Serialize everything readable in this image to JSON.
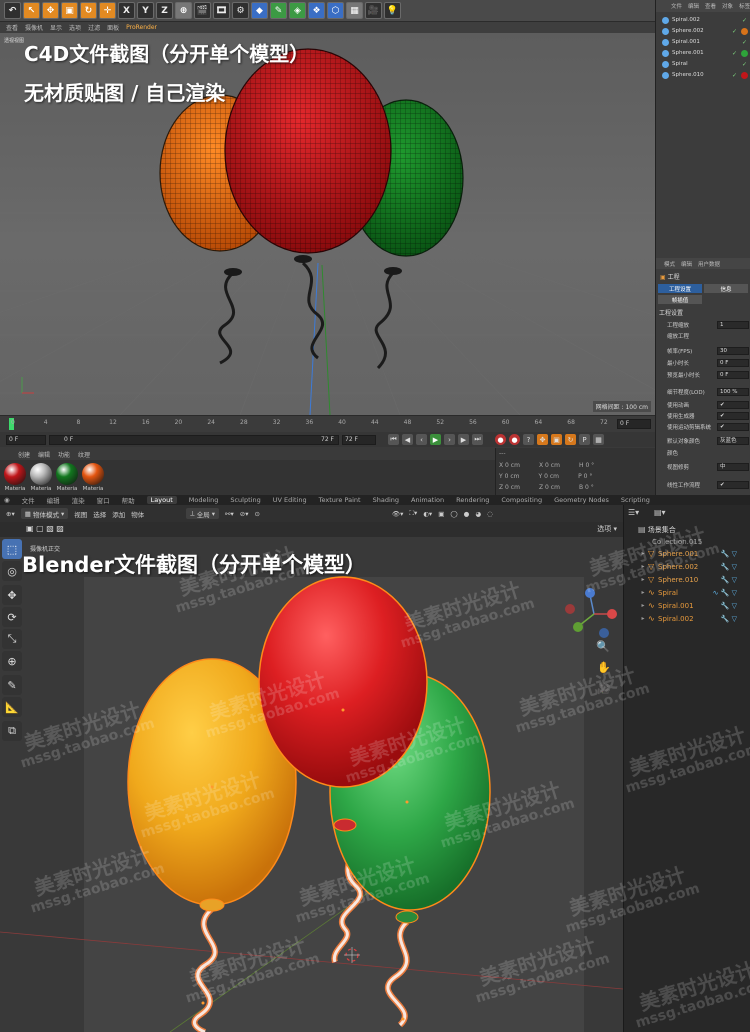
{
  "c4d": {
    "overlay_title": "C4D文件截图（分开单个模型）",
    "overlay_subtitle": "无材质贴图 / 自己渲染",
    "toolbar_xyz": [
      "X",
      "Y",
      "Z"
    ],
    "viewport_menu": [
      "查看",
      "摄像机",
      "显示",
      "选项",
      "过滤",
      "面板",
      "ProRender"
    ],
    "viewport_label": "透视视图",
    "grid_info": "网格间距 : 100 cm",
    "timeline_ticks": [
      "0",
      "4",
      "8",
      "12",
      "16",
      "20",
      "24",
      "28",
      "32",
      "36",
      "40",
      "44",
      "48",
      "52",
      "56",
      "60",
      "64",
      "68",
      "72"
    ],
    "current_frame": "0 F",
    "start_frame": "0 F",
    "range_start": "0 F",
    "range_end": "72 F",
    "end_frame": "72 F",
    "end_frame2": "72 F",
    "material_tabs": [
      "创建",
      "编辑",
      "功能",
      "纹理"
    ],
    "materials": [
      {
        "label": "Materia",
        "color": "#c0161a"
      },
      {
        "label": "Materia",
        "color": "#b8b8b8"
      },
      {
        "label": "Materia",
        "color": "#12781f"
      },
      {
        "label": "Materia",
        "color": "#e45510"
      }
    ],
    "coords": {
      "header": "---",
      "rows": [
        {
          "axis": "X",
          "pos": "0 cm",
          "axis2": "X",
          "size": "0 cm",
          "axis3": "H",
          "rot": "0 °"
        },
        {
          "axis": "Y",
          "pos": "0 cm",
          "axis2": "Y",
          "size": "0 cm",
          "axis3": "P",
          "rot": "0 °"
        },
        {
          "axis": "Z",
          "pos": "0 cm",
          "axis2": "Z",
          "size": "0 cm",
          "axis3": "B",
          "rot": "0 °"
        }
      ]
    },
    "object_menu": [
      "文件",
      "编辑",
      "查看",
      "对象",
      "标签"
    ],
    "objects": [
      {
        "name": "Spiral.002",
        "mat": ""
      },
      {
        "name": "Sphere.002",
        "mat": "#d8731a"
      },
      {
        "name": "Spiral.001",
        "mat": ""
      },
      {
        "name": "Sphere.001",
        "mat": "#2ea33a"
      },
      {
        "name": "Spiral",
        "mat": ""
      },
      {
        "name": "Sphere.010",
        "mat": "#c0161a"
      }
    ],
    "attr_menu": [
      "模式",
      "编辑",
      "用户数据"
    ],
    "attr_title": "工程",
    "attr_tabs": [
      "工程设置",
      "信息",
      "帧插值"
    ],
    "attr_section": "工程设置",
    "attr_rows": [
      {
        "label": "工程缩放",
        "value": "1"
      },
      {
        "label": "缩放工程",
        "value": ""
      },
      {
        "label": "帧率(FPS)",
        "value": "30"
      },
      {
        "label": "最小时长",
        "value": "0 F"
      },
      {
        "label": "预览最小时长",
        "value": "0 F"
      },
      {
        "label": "细节程度(LOD)",
        "value": "100 %"
      },
      {
        "label": "使用动画",
        "value": "✔"
      },
      {
        "label": "使用生成器",
        "value": "✔"
      },
      {
        "label": "使用运动剪辑系统",
        "value": "✔"
      },
      {
        "label": "默认对象颜色",
        "value": "灰蓝色"
      },
      {
        "label": "颜色",
        "value": ""
      },
      {
        "label": "视图修剪",
        "value": "中"
      },
      {
        "label": "线性工作流程",
        "value": "✔"
      }
    ]
  },
  "blender": {
    "overlay_title": "Blender文件截图（分开单个模型）",
    "workspaces": [
      "Layout",
      "Modeling",
      "Sculpting",
      "UV Editing",
      "Texture Paint",
      "Shading",
      "Animation",
      "Rendering",
      "Compositing",
      "Geometry Nodes",
      "Scripting"
    ],
    "active_workspace": "Layout",
    "left_menus": [
      "文件",
      "编辑",
      "渲染",
      "窗口",
      "帮助"
    ],
    "mode": "物体模式",
    "header_menu": [
      "视图",
      "选择",
      "添加",
      "物体"
    ],
    "transform": "全局",
    "options": "选项",
    "view_label": "摄像机正交",
    "outliner_title": "场景集合",
    "collection": "Collection.015",
    "outliner": [
      {
        "name": "Sphere.001",
        "type": "mesh"
      },
      {
        "name": "Sphere.002",
        "type": "mesh"
      },
      {
        "name": "Sphere.010",
        "type": "mesh"
      },
      {
        "name": "Spiral",
        "type": "curve"
      },
      {
        "name": "Spiral.001",
        "type": "curve"
      },
      {
        "name": "Spiral.002",
        "type": "curve"
      }
    ],
    "watermark_cn": "美素时光设计",
    "watermark_url": "mssg.taobao.com"
  }
}
